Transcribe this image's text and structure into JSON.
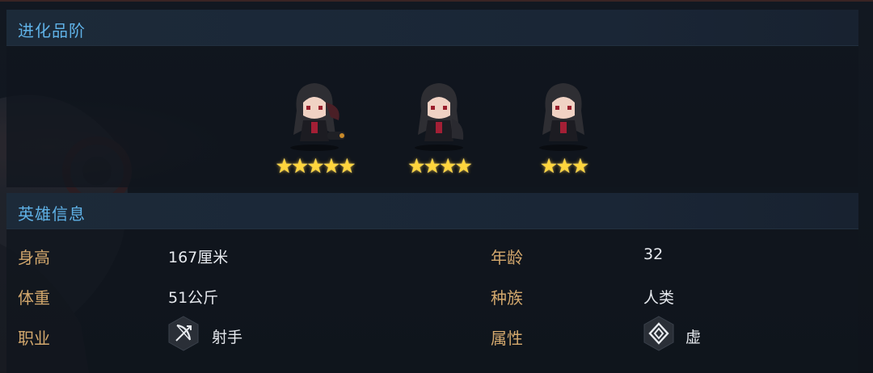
{
  "evolution": {
    "title": "进化品阶",
    "stages": [
      {
        "stars": "★★★★★",
        "count": 5
      },
      {
        "stars": "★★★★",
        "count": 4
      },
      {
        "stars": "★★★",
        "count": 3
      }
    ]
  },
  "hero_info": {
    "title": "英雄信息",
    "height_label": "身高",
    "height_value": "167厘米",
    "age_label": "年龄",
    "age_value": "32",
    "weight_label": "体重",
    "weight_value": "51公斤",
    "race_label": "种族",
    "race_value": "人类",
    "class_label": "职业",
    "class_value": "射手",
    "class_icon": "bow-icon",
    "attribute_label": "属性",
    "attribute_value": "虚",
    "attribute_icon": "void-attribute-icon"
  },
  "colors": {
    "header_text": "#5fb1e6",
    "label_text": "#d3a86d",
    "value_text": "#e6e9ee",
    "star": "#ffd53d"
  }
}
